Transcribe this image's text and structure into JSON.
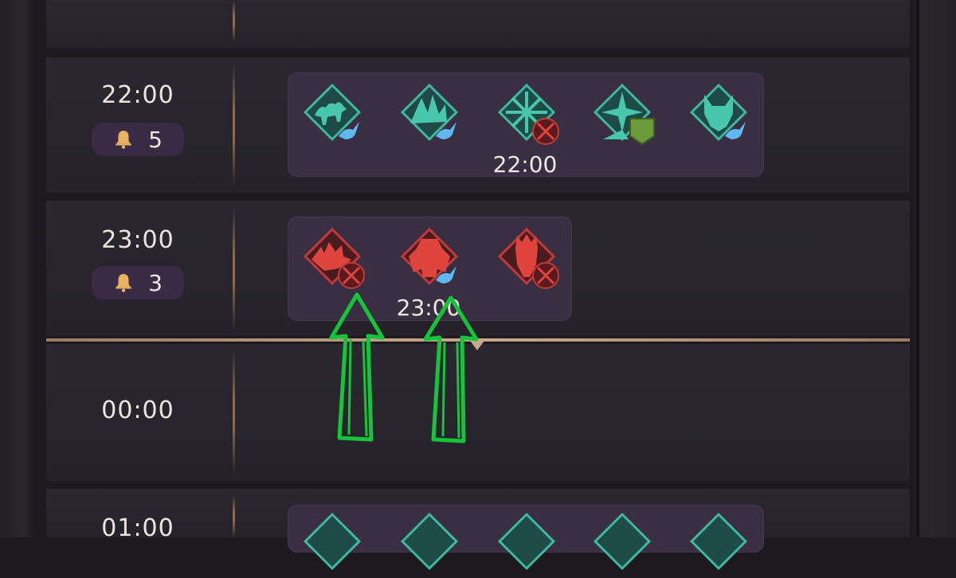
{
  "schedule": {
    "rows": [
      {
        "time": "22:00",
        "bell_count": "5",
        "panel_time": "22:00",
        "icons": [
          {
            "name": "camel-mount-icon",
            "color": "#3fb8a0",
            "overlay": "blue-dove-icon"
          },
          {
            "name": "wyvern-mount-icon",
            "color": "#3fb8a0",
            "overlay": "blue-dove-icon"
          },
          {
            "name": "snowflake-event-icon",
            "color": "#3fb8a0",
            "overlay": "red-crossed-swords-icon"
          },
          {
            "name": "compass-star-event-icon",
            "color": "#3fb8a0",
            "overlay": "green-shield-icon"
          },
          {
            "name": "wolf-mount-icon",
            "color": "#3fb8a0",
            "overlay": "blue-dove-icon"
          }
        ]
      },
      {
        "time": "23:00",
        "bell_count": "3",
        "panel_time": "23:00",
        "icons": [
          {
            "name": "wild-beast-boss-icon",
            "color": "#e0453d",
            "overlay": "red-crossed-swords-icon"
          },
          {
            "name": "golem-boss-icon",
            "color": "#e0453d",
            "overlay": "blue-dove-icon"
          },
          {
            "name": "warlord-boss-icon",
            "color": "#e0453d",
            "overlay": "red-crossed-swords-icon"
          }
        ]
      },
      {
        "time": "00:00"
      },
      {
        "time": "01:00"
      }
    ]
  },
  "colors": {
    "accent_teal": "#3fb8a0",
    "boss_red": "#e0453d",
    "dove_blue": "#5fb8f0",
    "shield_green": "#6a9a3a",
    "annotation_green": "#16c43c"
  }
}
